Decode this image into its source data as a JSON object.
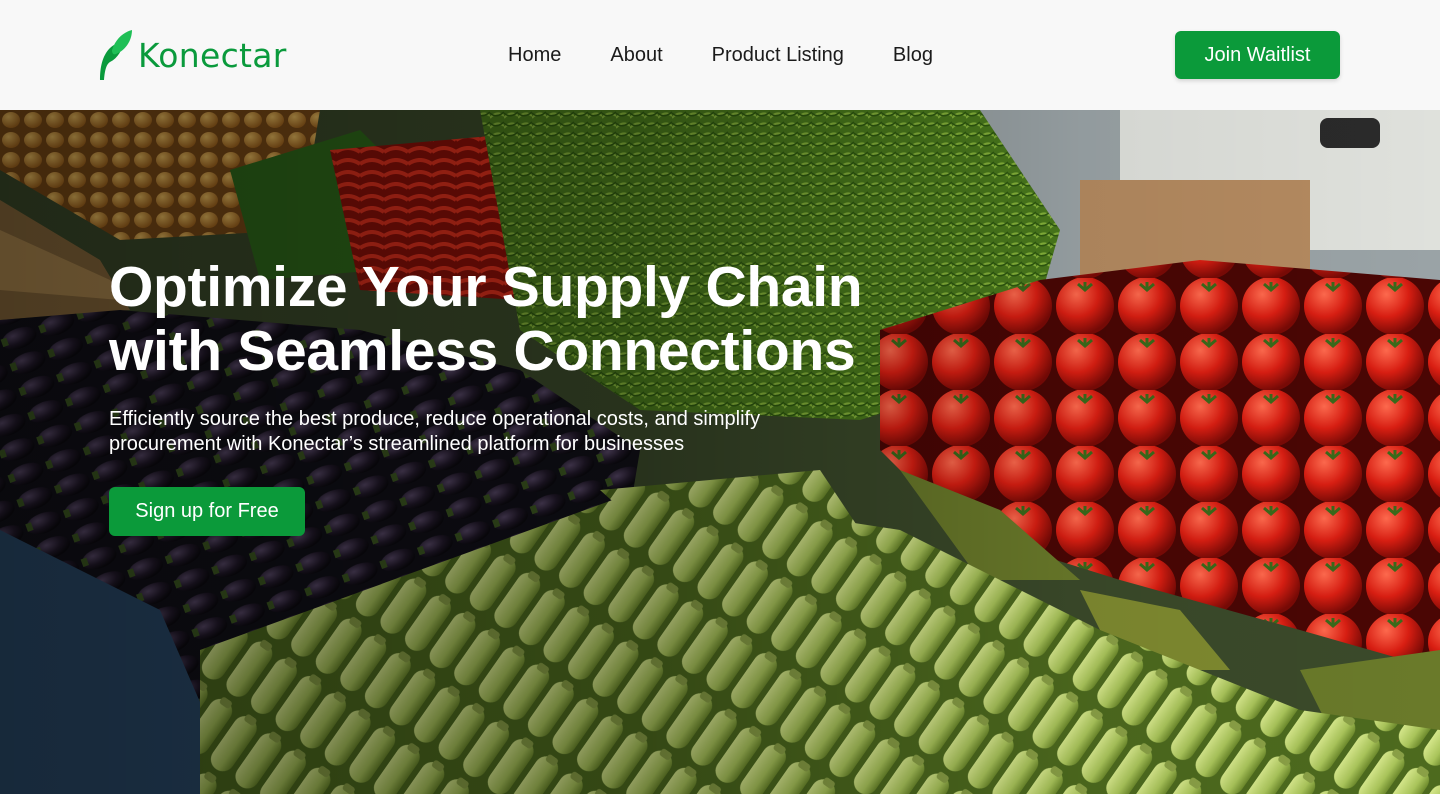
{
  "brand": {
    "name": "Konectar",
    "icon": "leaf-icon",
    "color": "#0a9a3c"
  },
  "nav": {
    "links": [
      "Home",
      "About",
      "Product Listing",
      "Blog"
    ],
    "cta_label": "Join Waitlist"
  },
  "hero": {
    "title_line1": "Optimize Your Supply Chain",
    "title_line2": "with Seamless Connections",
    "subtitle": "Efficiently source the best produce, reduce operational costs, and simplify procurement with Konectar’s streamlined platform for businesses",
    "cta_label": "Sign up for Free",
    "background": "produce-market-photo"
  },
  "colors": {
    "accent": "#0b9a3a",
    "nav_bg": "#f8f8f8",
    "nav_text": "#1b1b1b"
  }
}
